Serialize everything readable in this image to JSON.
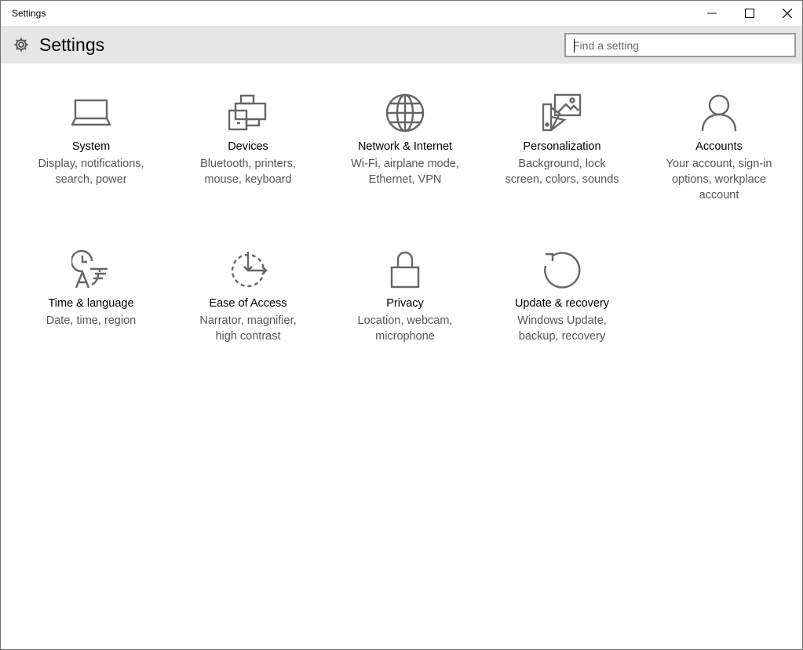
{
  "window": {
    "title": "Settings"
  },
  "header": {
    "app_title": "Settings",
    "search": {
      "placeholder": "Find a setting",
      "value": ""
    }
  },
  "tiles": [
    {
      "id": "system",
      "name": "System",
      "desc": "Display, notifications, search, power",
      "icon": "laptop-icon"
    },
    {
      "id": "devices",
      "name": "Devices",
      "desc": "Bluetooth, printers, mouse, keyboard",
      "icon": "printer-icon"
    },
    {
      "id": "network",
      "name": "Network & Internet",
      "desc": "Wi-Fi, airplane mode, Ethernet, VPN",
      "icon": "globe-icon"
    },
    {
      "id": "personalization",
      "name": "Personalization",
      "desc": "Background, lock screen, colors, sounds",
      "icon": "paint-palette-icon"
    },
    {
      "id": "accounts",
      "name": "Accounts",
      "desc": "Your account, sign-in options, workplace account",
      "icon": "person-icon"
    },
    {
      "id": "time-language",
      "name": "Time & language",
      "desc": "Date, time, region",
      "icon": "clock-language-icon"
    },
    {
      "id": "ease-of-access",
      "name": "Ease of Access",
      "desc": "Narrator, magnifier, high contrast",
      "icon": "ease-of-access-icon"
    },
    {
      "id": "privacy",
      "name": "Privacy",
      "desc": "Location, webcam, microphone",
      "icon": "lock-icon"
    },
    {
      "id": "update-recovery",
      "name": "Update & recovery",
      "desc": "Windows Update, backup, recovery",
      "icon": "refresh-icon"
    }
  ],
  "colors": {
    "header_bg": "#e6e6e6",
    "icon_stroke": "#666666",
    "desc_text": "#555555"
  }
}
